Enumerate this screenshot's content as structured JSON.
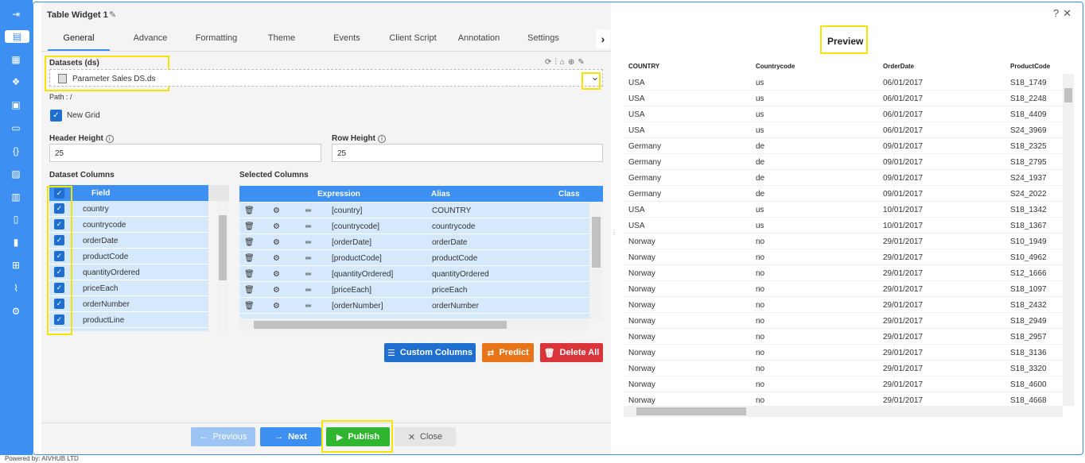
{
  "powered_by": "Powered by: AIVHUB LTD",
  "rail_icons": [
    "login-icon",
    "table-icon",
    "chart-icon",
    "cubes-icon",
    "report-icon",
    "card-icon",
    "code-icon",
    "image-chart-icon",
    "layout-icon",
    "file-icon",
    "doc-icon",
    "hierarchy-icon",
    "trend-icon",
    "settings-gear-icon"
  ],
  "dialog": {
    "title": "Table Widget 1",
    "help": "?",
    "close": "✕"
  },
  "tabs": [
    "General",
    "Advance",
    "Formatting",
    "Theme",
    "Events",
    "Client Script",
    "Annotation",
    "Settings"
  ],
  "datasets": {
    "label": "Datasets (ds)",
    "selected": "Parameter Sales DS.ds",
    "path": "Path : /"
  },
  "new_grid": {
    "label": "New Grid",
    "checked": true
  },
  "header_height": {
    "label": "Header Height",
    "value": "25"
  },
  "row_height": {
    "label": "Row Height",
    "value": "25"
  },
  "dataset_columns": {
    "label": "Dataset Columns",
    "header": "Field",
    "fields": [
      "country",
      "countrycode",
      "orderDate",
      "productCode",
      "quantityOrdered",
      "priceEach",
      "orderNumber",
      "productLine"
    ]
  },
  "selected_columns": {
    "label": "Selected Columns",
    "headers": [
      "Expression",
      "Alias",
      "Class"
    ],
    "rows": [
      {
        "expression": "[country]",
        "alias": "COUNTRY"
      },
      {
        "expression": "[countrycode]",
        "alias": "countrycode"
      },
      {
        "expression": "[orderDate]",
        "alias": "orderDate"
      },
      {
        "expression": "[productCode]",
        "alias": "productCode"
      },
      {
        "expression": "[quantityOrdered]",
        "alias": "quantityOrdered"
      },
      {
        "expression": "[priceEach]",
        "alias": "priceEach"
      },
      {
        "expression": "[orderNumber]",
        "alias": "orderNumber"
      }
    ]
  },
  "actions": {
    "custom_columns": "Custom Columns",
    "predict": "Predict",
    "delete_all": "Delete All"
  },
  "footer": {
    "previous": "Previous",
    "next": "Next",
    "publish": "Publish",
    "close": "Close"
  },
  "preview": {
    "title": "Preview",
    "headers": [
      "COUNTRY",
      "Countrycode",
      "OrderDate",
      "ProductCode"
    ],
    "rows": [
      [
        "USA",
        "us",
        "06/01/2017",
        "S18_1749"
      ],
      [
        "USA",
        "us",
        "06/01/2017",
        "S18_2248"
      ],
      [
        "USA",
        "us",
        "06/01/2017",
        "S18_4409"
      ],
      [
        "USA",
        "us",
        "06/01/2017",
        "S24_3969"
      ],
      [
        "Germany",
        "de",
        "09/01/2017",
        "S18_2325"
      ],
      [
        "Germany",
        "de",
        "09/01/2017",
        "S18_2795"
      ],
      [
        "Germany",
        "de",
        "09/01/2017",
        "S24_1937"
      ],
      [
        "Germany",
        "de",
        "09/01/2017",
        "S24_2022"
      ],
      [
        "USA",
        "us",
        "10/01/2017",
        "S18_1342"
      ],
      [
        "USA",
        "us",
        "10/01/2017",
        "S18_1367"
      ],
      [
        "Norway",
        "no",
        "29/01/2017",
        "S10_1949"
      ],
      [
        "Norway",
        "no",
        "29/01/2017",
        "S10_4962"
      ],
      [
        "Norway",
        "no",
        "29/01/2017",
        "S12_1666"
      ],
      [
        "Norway",
        "no",
        "29/01/2017",
        "S18_1097"
      ],
      [
        "Norway",
        "no",
        "29/01/2017",
        "S18_2432"
      ],
      [
        "Norway",
        "no",
        "29/01/2017",
        "S18_2949"
      ],
      [
        "Norway",
        "no",
        "29/01/2017",
        "S18_2957"
      ],
      [
        "Norway",
        "no",
        "29/01/2017",
        "S18_3136"
      ],
      [
        "Norway",
        "no",
        "29/01/2017",
        "S18_3320"
      ],
      [
        "Norway",
        "no",
        "29/01/2017",
        "S18_4600"
      ],
      [
        "Norway",
        "no",
        "29/01/2017",
        "S18_4668"
      ]
    ]
  },
  "colors": {
    "accent": "#3d8ff2",
    "publish": "#2fb52f",
    "predict": "#e8741a",
    "delete": "#d9343a",
    "highlight": "#f5e400"
  }
}
